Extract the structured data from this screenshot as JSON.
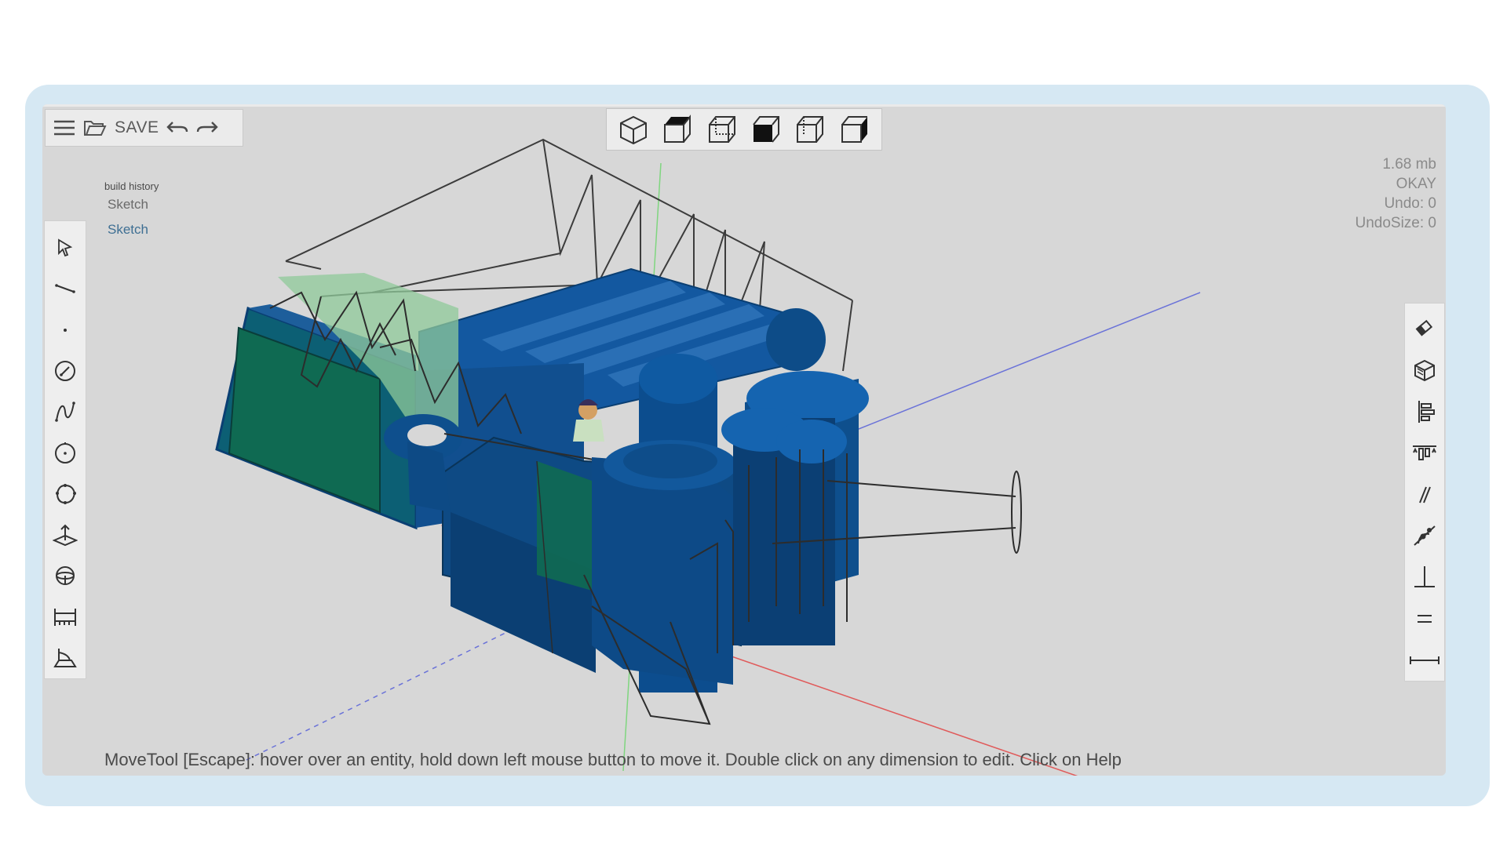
{
  "toolbar": {
    "save_label": "SAVE",
    "icons": [
      "menu-icon",
      "open-folder-icon",
      "undo-icon",
      "redo-icon"
    ]
  },
  "view_toolbar": {
    "icons": [
      "view-iso-icon",
      "view-top-icon",
      "view-front-icon",
      "view-left-icon",
      "view-right-icon",
      "view-back-icon"
    ]
  },
  "history": {
    "title": "build history",
    "items": [
      {
        "label": "Sketch",
        "active": false
      },
      {
        "label": "Sketch",
        "active": true
      }
    ]
  },
  "stats": {
    "size": "1.68 mb",
    "status": "OKAY",
    "undo": "Undo: 0",
    "undo_size": "UndoSize: 0"
  },
  "left_tools": [
    "select-arrow-icon",
    "line-tool-icon",
    "point-tool-icon",
    "arc-tool-icon",
    "spline-tool-icon",
    "circle-tool-icon",
    "polygon-tool-icon",
    "extrude-tool-icon",
    "revolve-tool-icon",
    "dimension-tool-icon",
    "plane-tool-icon"
  ],
  "right_tools": [
    "eraser-icon",
    "solid-cube-icon",
    "align-left-icon",
    "align-center-icon",
    "parallel-icon",
    "tangent-icon",
    "perpendicular-icon",
    "equal-icon",
    "distance-icon"
  ],
  "status_message": "MoveTool [Escape]: hover over an entity, hold down left mouse button to move it. Double click on any dimension to edit. Click on Help",
  "colors": {
    "background": "#d7d7d7",
    "frame": "#d6e8f3",
    "solid_blue": "#0e4f8d",
    "solid_dark": "#0a3f73",
    "face_green": "#0f6a52",
    "sketch_green": "#8fc99a",
    "active_history": "#3e6f93"
  }
}
